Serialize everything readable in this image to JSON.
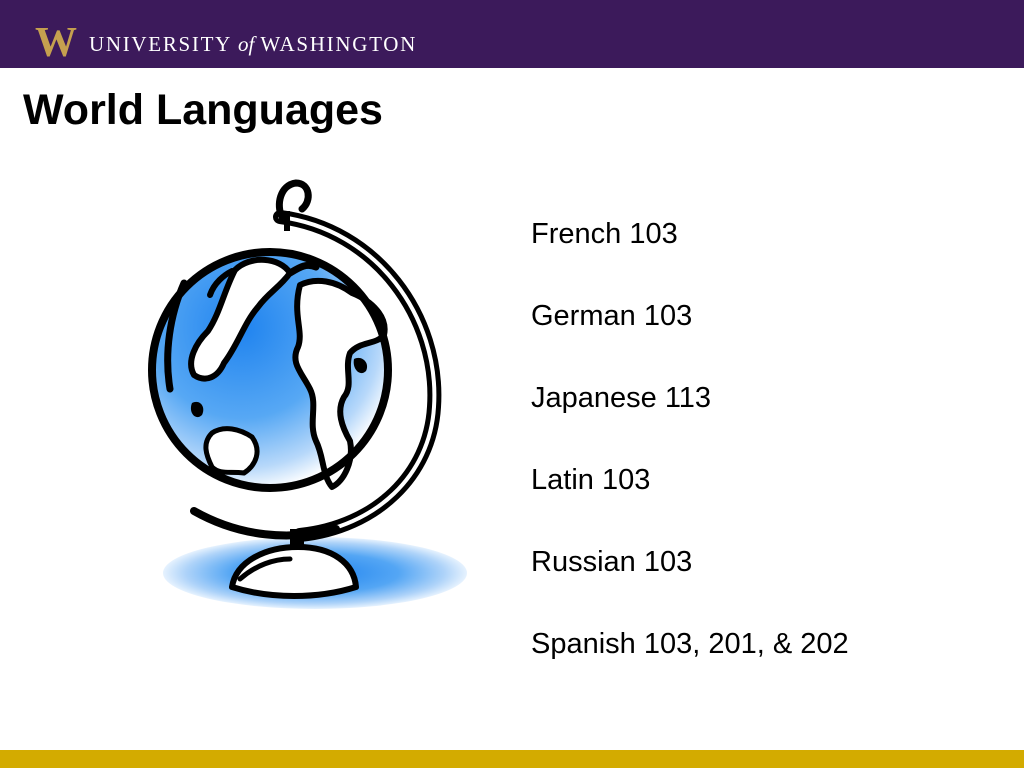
{
  "header": {
    "logo_letter": "W",
    "wordmark_part1": "UNIVERSITY",
    "wordmark_of": "of",
    "wordmark_part2": "WASHINGTON"
  },
  "slide": {
    "title": "World Languages",
    "courses": [
      "French 103",
      "German 103",
      "Japanese 113",
      "Latin 103",
      "Russian 103",
      "Spanish 103, 201, & 202"
    ]
  },
  "colors": {
    "header_bg": "#3c1a5b",
    "logo_gold": "#c5a04f",
    "footer_gold": "#d3ab00",
    "globe_blue": "#2b8cf0"
  },
  "icons": {
    "logo": "uw-w-logo",
    "clipart": "globe-icon"
  }
}
